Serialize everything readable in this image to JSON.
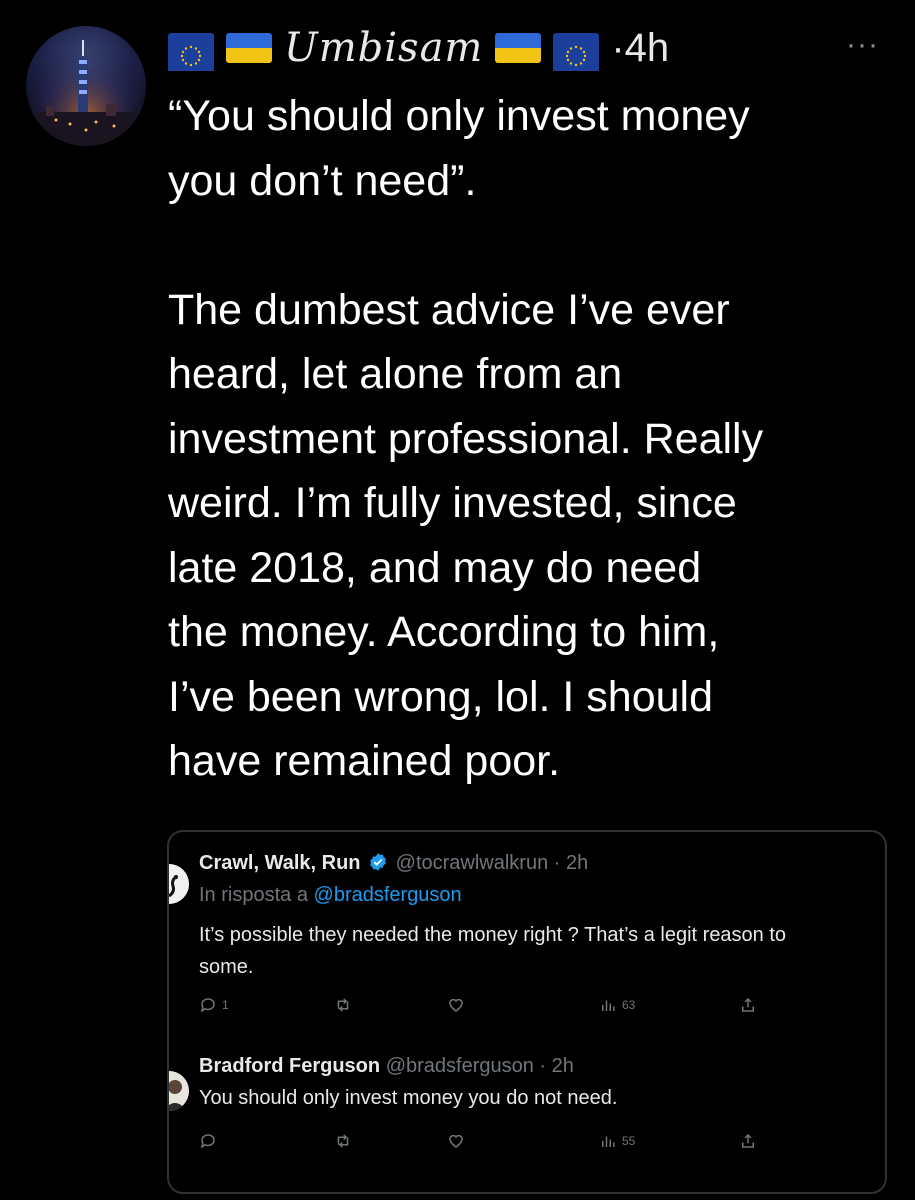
{
  "tweet": {
    "author_display": "Umbisam",
    "time": "·4h",
    "more_label": "···",
    "text": "“You should only invest money\nyou don’t need”.\n\nThe dumbest advice I’ve ever\nheard, let alone from an\ninvestment professional. Really\nweird. I’m fully invested, since\nlate 2018, and may do need\nthe money. According to him,\nI’ve been wrong, lol. I should\nhave remained poor."
  },
  "quote": {
    "reply1": {
      "name": "Crawl, Walk, Run",
      "handle": "@tocrawlwalkrun",
      "time": "· 2h",
      "reply_prefix": "In risposta a",
      "reply_to": "@bradsferguson",
      "text_line1": "It’s possible they needed the money right ? That’s a legit reason to",
      "text_line2": "some.",
      "reply_count": "1",
      "retweet_count": "",
      "like_count": "",
      "view_count": "63"
    },
    "reply2": {
      "name": "Bradford Ferguson",
      "handle": "@bradsferguson",
      "time": "· 2h",
      "text": "You should only invest money you do not need.",
      "reply_count": "",
      "retweet_count": "",
      "like_count": "",
      "view_count": "55"
    }
  },
  "icons": {
    "flag_eu": "eu-flag-icon",
    "flag_ua": "ukraine-flag-icon",
    "verified": "verified-badge-icon",
    "reply": "reply-icon",
    "retweet": "retweet-icon",
    "like": "like-icon",
    "views": "views-icon",
    "share": "share-icon"
  },
  "colors": {
    "background": "#000000",
    "text": "#ffffff",
    "muted": "#71767b",
    "link": "#1d9bf0",
    "border": "#2f3336"
  }
}
